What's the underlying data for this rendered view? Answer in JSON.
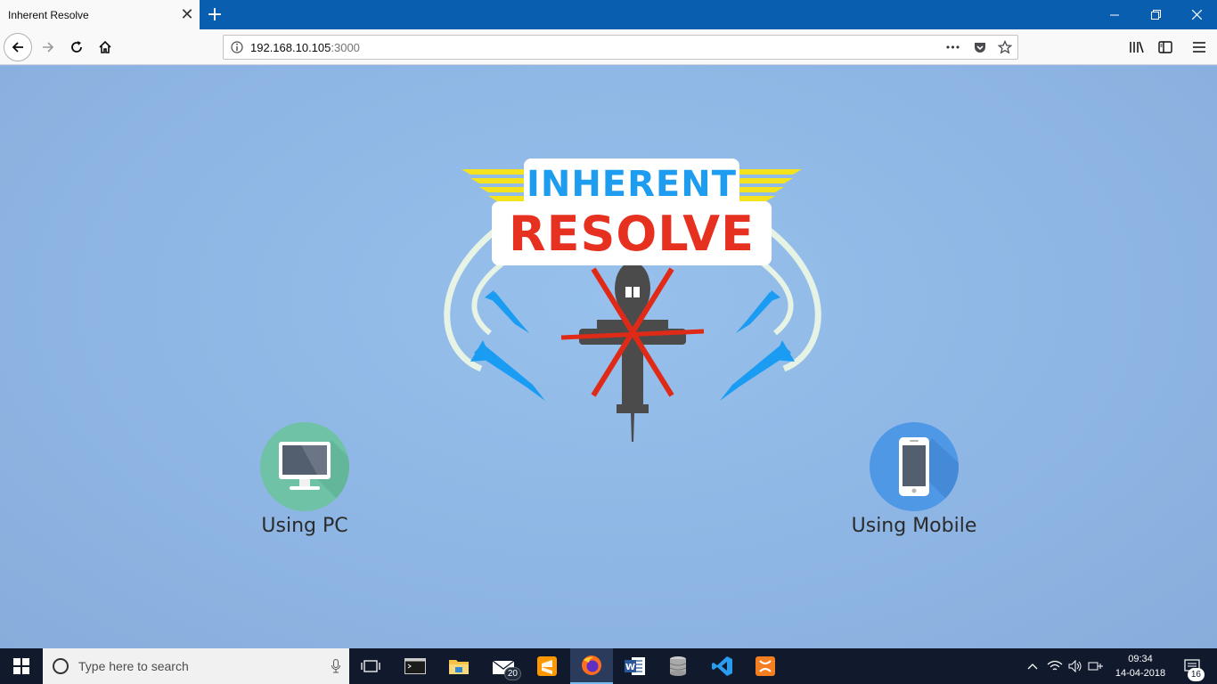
{
  "browser": {
    "tab_title": "Inherent Resolve",
    "tab_close_glyph": "✕",
    "new_tab_glyph": "+",
    "url_host": "192.168.10.105",
    "url_port": ":3000",
    "url_more_glyph": "•••"
  },
  "page": {
    "logo_top_word": "INHERENT",
    "logo_bottom_word": "RESOLVE",
    "option_pc_label": "Using PC",
    "option_mobile_label": "Using Mobile"
  },
  "taskbar": {
    "search_placeholder": "Type here to search",
    "mail_badge": "20",
    "clock_time": "09:34",
    "clock_date": "14-04-2018",
    "notification_badge": "16"
  },
  "colors": {
    "titlebar": "#0a5eb0",
    "content_bg": "#8fb6e4",
    "logo_blue": "#1e9cf0",
    "logo_red": "#e63020",
    "pc_circle": "#6fc2a6",
    "mobile_circle": "#4f98e6",
    "taskbar": "#101a2c"
  },
  "icons": [
    "back-icon",
    "forward-icon",
    "reload-icon",
    "home-icon",
    "info-icon",
    "pocket-icon",
    "star-icon",
    "library-icon",
    "sidebar-icon",
    "menu-icon",
    "windows-icon",
    "cortana-icon",
    "microphone-icon",
    "task-view-icon",
    "terminal-icon",
    "file-explorer-icon",
    "mail-icon",
    "sublime-icon",
    "firefox-icon",
    "word-icon",
    "database-icon",
    "vscode-icon",
    "xampp-icon",
    "chevron-up-icon",
    "wifi-icon",
    "volume-icon",
    "network-icon",
    "notification-icon"
  ]
}
